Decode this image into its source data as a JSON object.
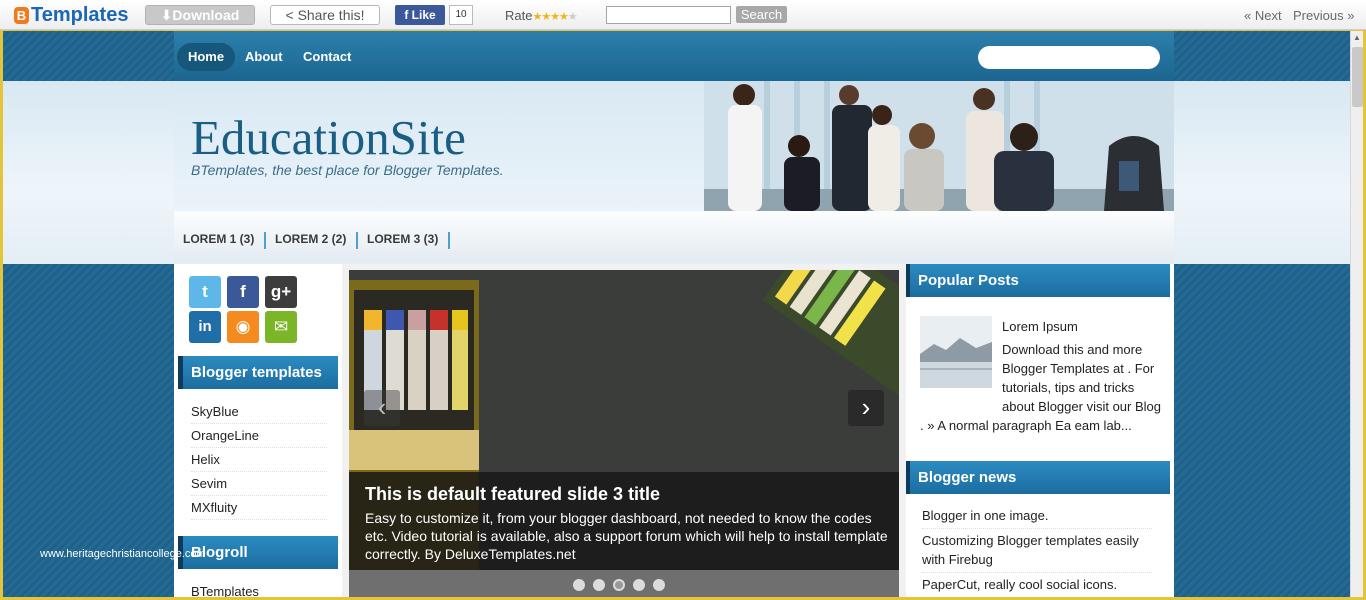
{
  "topbar": {
    "logo_text": "Templates",
    "logo_badge": "B",
    "download_label": "Download",
    "share_label": "Share this!",
    "like_label": "Like",
    "like_count": "10",
    "rate_label": "Rate",
    "rating": "4 of 5",
    "search_value": "",
    "search_label": "Search",
    "next_label": "« Next",
    "previous_label": "Previous »"
  },
  "nav": {
    "home": "Home",
    "about": "About",
    "contact": "Contact",
    "search_value": ""
  },
  "header": {
    "title": "EducationSite",
    "tagline": "BTemplates, the best place for Blogger Templates."
  },
  "categories": [
    {
      "label": "LOREM 1 (3)"
    },
    {
      "label": "LOREM 2 (2)"
    },
    {
      "label": "LOREM 3 (3)"
    }
  ],
  "sidebar_left": {
    "social": [
      "twitter-icon",
      "facebook-icon",
      "google-plus-icon",
      "linkedin-icon",
      "rss-icon",
      "email-icon"
    ],
    "blogger_title": "Blogger templates",
    "blogger_links": [
      "SkyBlue",
      "OrangeLine",
      "Helix",
      "Sevim",
      "MXfluity"
    ],
    "blogroll_title": "Blogroll",
    "blogroll_links": [
      "BTemplates"
    ]
  },
  "slider": {
    "title": "This is default featured slide 3 title",
    "description": "Easy to customize it, from your blogger dashboard, not needed to know the codes etc. Video tutorial is available, also a support forum which will help to install template correctly. By DeluxeTemplates.net",
    "dots": 5,
    "active_dot": 3
  },
  "sidebar_right": {
    "popular_title": "Popular Posts",
    "popular_post_title": "Lorem Ipsum",
    "popular_post_text_a": "Download this and more Blogger Templates at . For tutorials, tips and tricks about Blogger visit our Blog",
    "popular_post_text_b": ". » A normal paragraph Ea eam lab...",
    "news_title": "Blogger news",
    "news_items": [
      "Blogger in one image.",
      "Customizing Blogger templates easily with Firebug",
      "PaperCut, really cool social icons."
    ]
  },
  "watermark": "www.heritagechristiancollege.com",
  "colors": {
    "accent": "#1f6189",
    "brand": "#1c66b6",
    "logo_badge": "#f07a1c"
  }
}
